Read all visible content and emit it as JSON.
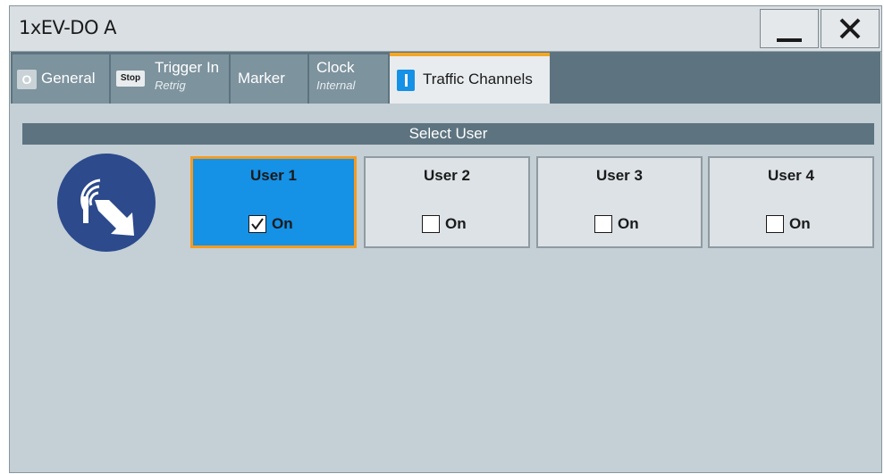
{
  "window": {
    "title": "1xEV-DO A"
  },
  "window_controls": {
    "minimize": "minimize-icon",
    "close": "close-icon"
  },
  "tabs": [
    {
      "label": "General",
      "badge": "O"
    },
    {
      "label": "Trigger In",
      "sub": "Retrig",
      "badge": "Stop"
    },
    {
      "label": "Marker"
    },
    {
      "label": "Clock",
      "sub": "Internal"
    },
    {
      "label": "Traffic Channels",
      "active": true
    }
  ],
  "section": {
    "title": "Select User"
  },
  "users": [
    {
      "name": "User 1",
      "on_label": "On",
      "checked": true,
      "selected": true
    },
    {
      "name": "User 2",
      "on_label": "On",
      "checked": false,
      "selected": false
    },
    {
      "name": "User 3",
      "on_label": "On",
      "checked": false,
      "selected": false
    },
    {
      "name": "User 4",
      "on_label": "On",
      "checked": false,
      "selected": false
    }
  ],
  "colors": {
    "accent": "#1591e6",
    "active_tab_marker": "#f5a623",
    "selection_border": "#f59b1f",
    "tabbar": "#5d7480",
    "logo": "#2c4a8c"
  }
}
